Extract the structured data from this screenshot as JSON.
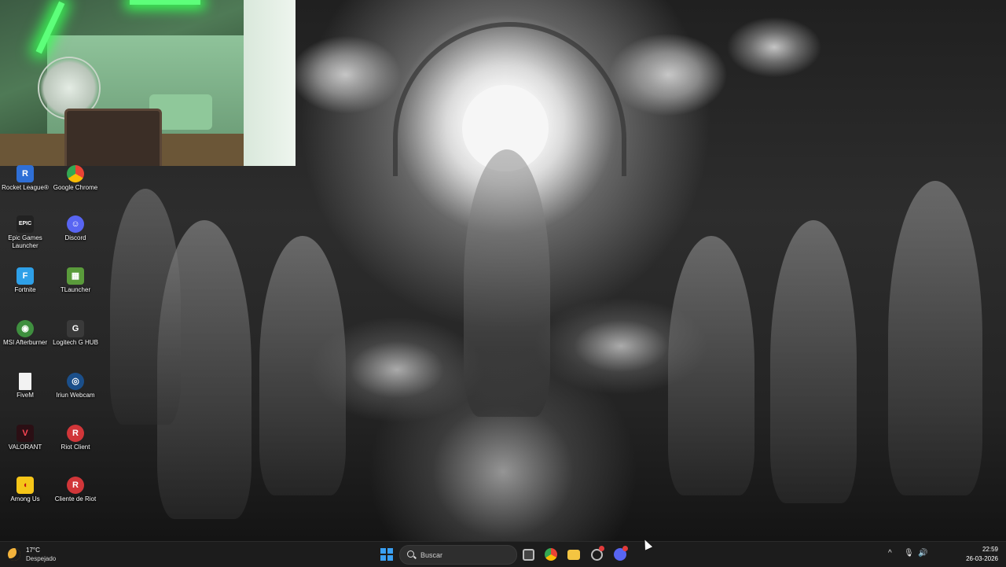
{
  "desktop": {
    "icons": [
      {
        "label": "Rocket League®",
        "icon": "rocket-league-icon",
        "color": "#2f6fd6",
        "glyph": "R"
      },
      {
        "label": "Google Chrome",
        "icon": "chrome-icon",
        "color": "#4285f4",
        "glyph": "●"
      },
      {
        "label": "Epic Games Launcher",
        "icon": "epic-games-icon",
        "color": "#222222",
        "glyph": "EPIC"
      },
      {
        "label": "Discord",
        "icon": "discord-icon",
        "color": "#5865f2",
        "glyph": "☺"
      },
      {
        "label": "Fortnite",
        "icon": "fortnite-icon",
        "color": "#2ea0e8",
        "glyph": "F"
      },
      {
        "label": "TLauncher",
        "icon": "tlauncher-icon",
        "color": "#5a9b3b",
        "glyph": "▦"
      },
      {
        "label": "MSI Afterburner",
        "icon": "msi-afterburner-icon",
        "color": "#3f8f3f",
        "glyph": "◉"
      },
      {
        "label": "Logitech G HUB",
        "icon": "logitech-ghub-icon",
        "color": "#3a3a3a",
        "glyph": "G"
      },
      {
        "label": "FiveM",
        "icon": "fivem-file-icon",
        "color": "#f2f2f2",
        "glyph": ""
      },
      {
        "label": "Iriun Webcam",
        "icon": "iriun-webcam-icon",
        "color": "#1b4f8a",
        "glyph": "◎"
      },
      {
        "label": "VALORANT",
        "icon": "valorant-icon",
        "color": "#2b0f14",
        "glyph": "V"
      },
      {
        "label": "Riot Client",
        "icon": "riot-client-icon",
        "color": "#d13639",
        "glyph": "R"
      },
      {
        "label": "Among Us",
        "icon": "among-us-icon",
        "color": "#c51111",
        "glyph": "◖"
      },
      {
        "label": "Cliente de Riot",
        "icon": "riot-client-icon",
        "color": "#d13639",
        "glyph": "R"
      }
    ]
  },
  "taskbar": {
    "weather": {
      "temp": "17°C",
      "condition": "Despejado",
      "icon": "moon-weather-icon"
    },
    "search": {
      "placeholder": "Buscar"
    },
    "apps": [
      {
        "name": "task-view",
        "icon": "task-view-icon",
        "color": "#bdbdbd"
      },
      {
        "name": "chrome",
        "icon": "chrome-icon",
        "color": "#4285f4"
      },
      {
        "name": "file-explorer",
        "icon": "folder-icon",
        "color": "#f4c542"
      },
      {
        "name": "app-with-notification",
        "icon": "app-icon",
        "color": "#9e9e9e"
      },
      {
        "name": "discord",
        "icon": "discord-icon",
        "color": "#5865f2"
      }
    ],
    "tray": {
      "chevron": "^",
      "mic": "🎙",
      "volume": "🔊"
    },
    "clock": {
      "time": "22:59",
      "date": "26-03-2026"
    }
  }
}
